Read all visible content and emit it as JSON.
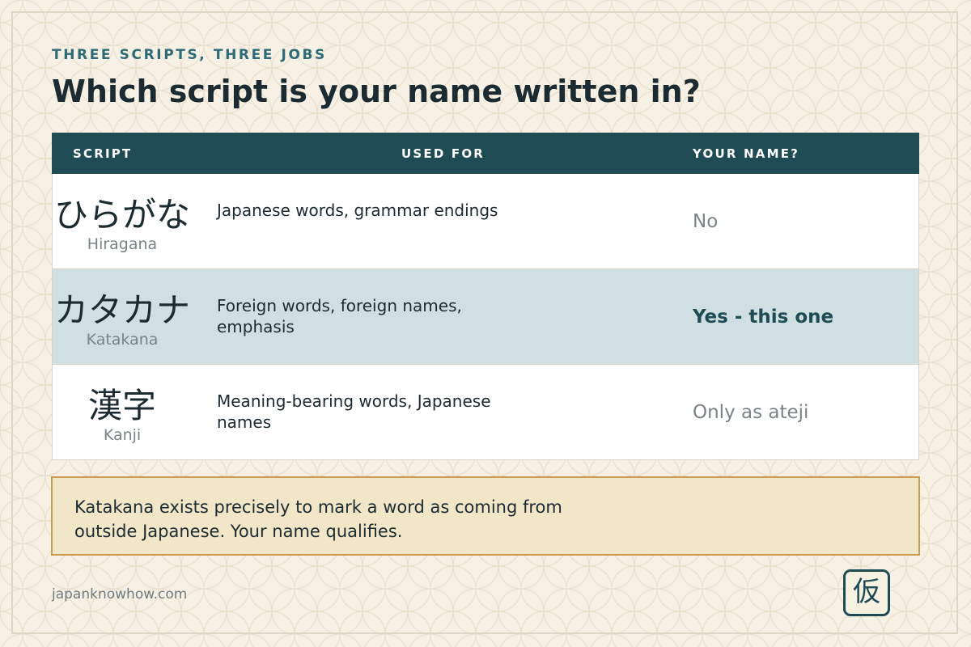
{
  "header": {
    "kicker": "THREE SCRIPTS, THREE JOBS",
    "title": "Which script is your name written in?"
  },
  "table": {
    "columns": [
      "SCRIPT",
      "USED FOR",
      "YOUR NAME?"
    ],
    "rows": [
      {
        "script": "ひらがな",
        "romaji": "Hiragana",
        "used_for": "Japanese words, grammar endings",
        "your_name": "No",
        "highlighted": false
      },
      {
        "script": "カタカナ",
        "romaji": "Katakana",
        "used_for": "Foreign words, foreign names, emphasis",
        "your_name": "Yes - this one",
        "highlighted": true
      },
      {
        "script": "漢字",
        "romaji": "Kanji",
        "used_for": "Meaning-bearing words, Japanese names",
        "your_name": "Only as ateji",
        "highlighted": false
      }
    ]
  },
  "note": {
    "text": "Katakana exists precisely to mark a word as coming from outside Japanese. Your name qualifies."
  },
  "footer": {
    "site": "japanknowhow.com",
    "seal": "仮"
  },
  "colors": {
    "background": "#f6f1e4",
    "header_bar": "#1f4b55",
    "kicker": "#2d6b76",
    "highlight_row": "#cfdfe2",
    "note_background": "#f2e6c9",
    "note_border": "#c99a4f"
  }
}
